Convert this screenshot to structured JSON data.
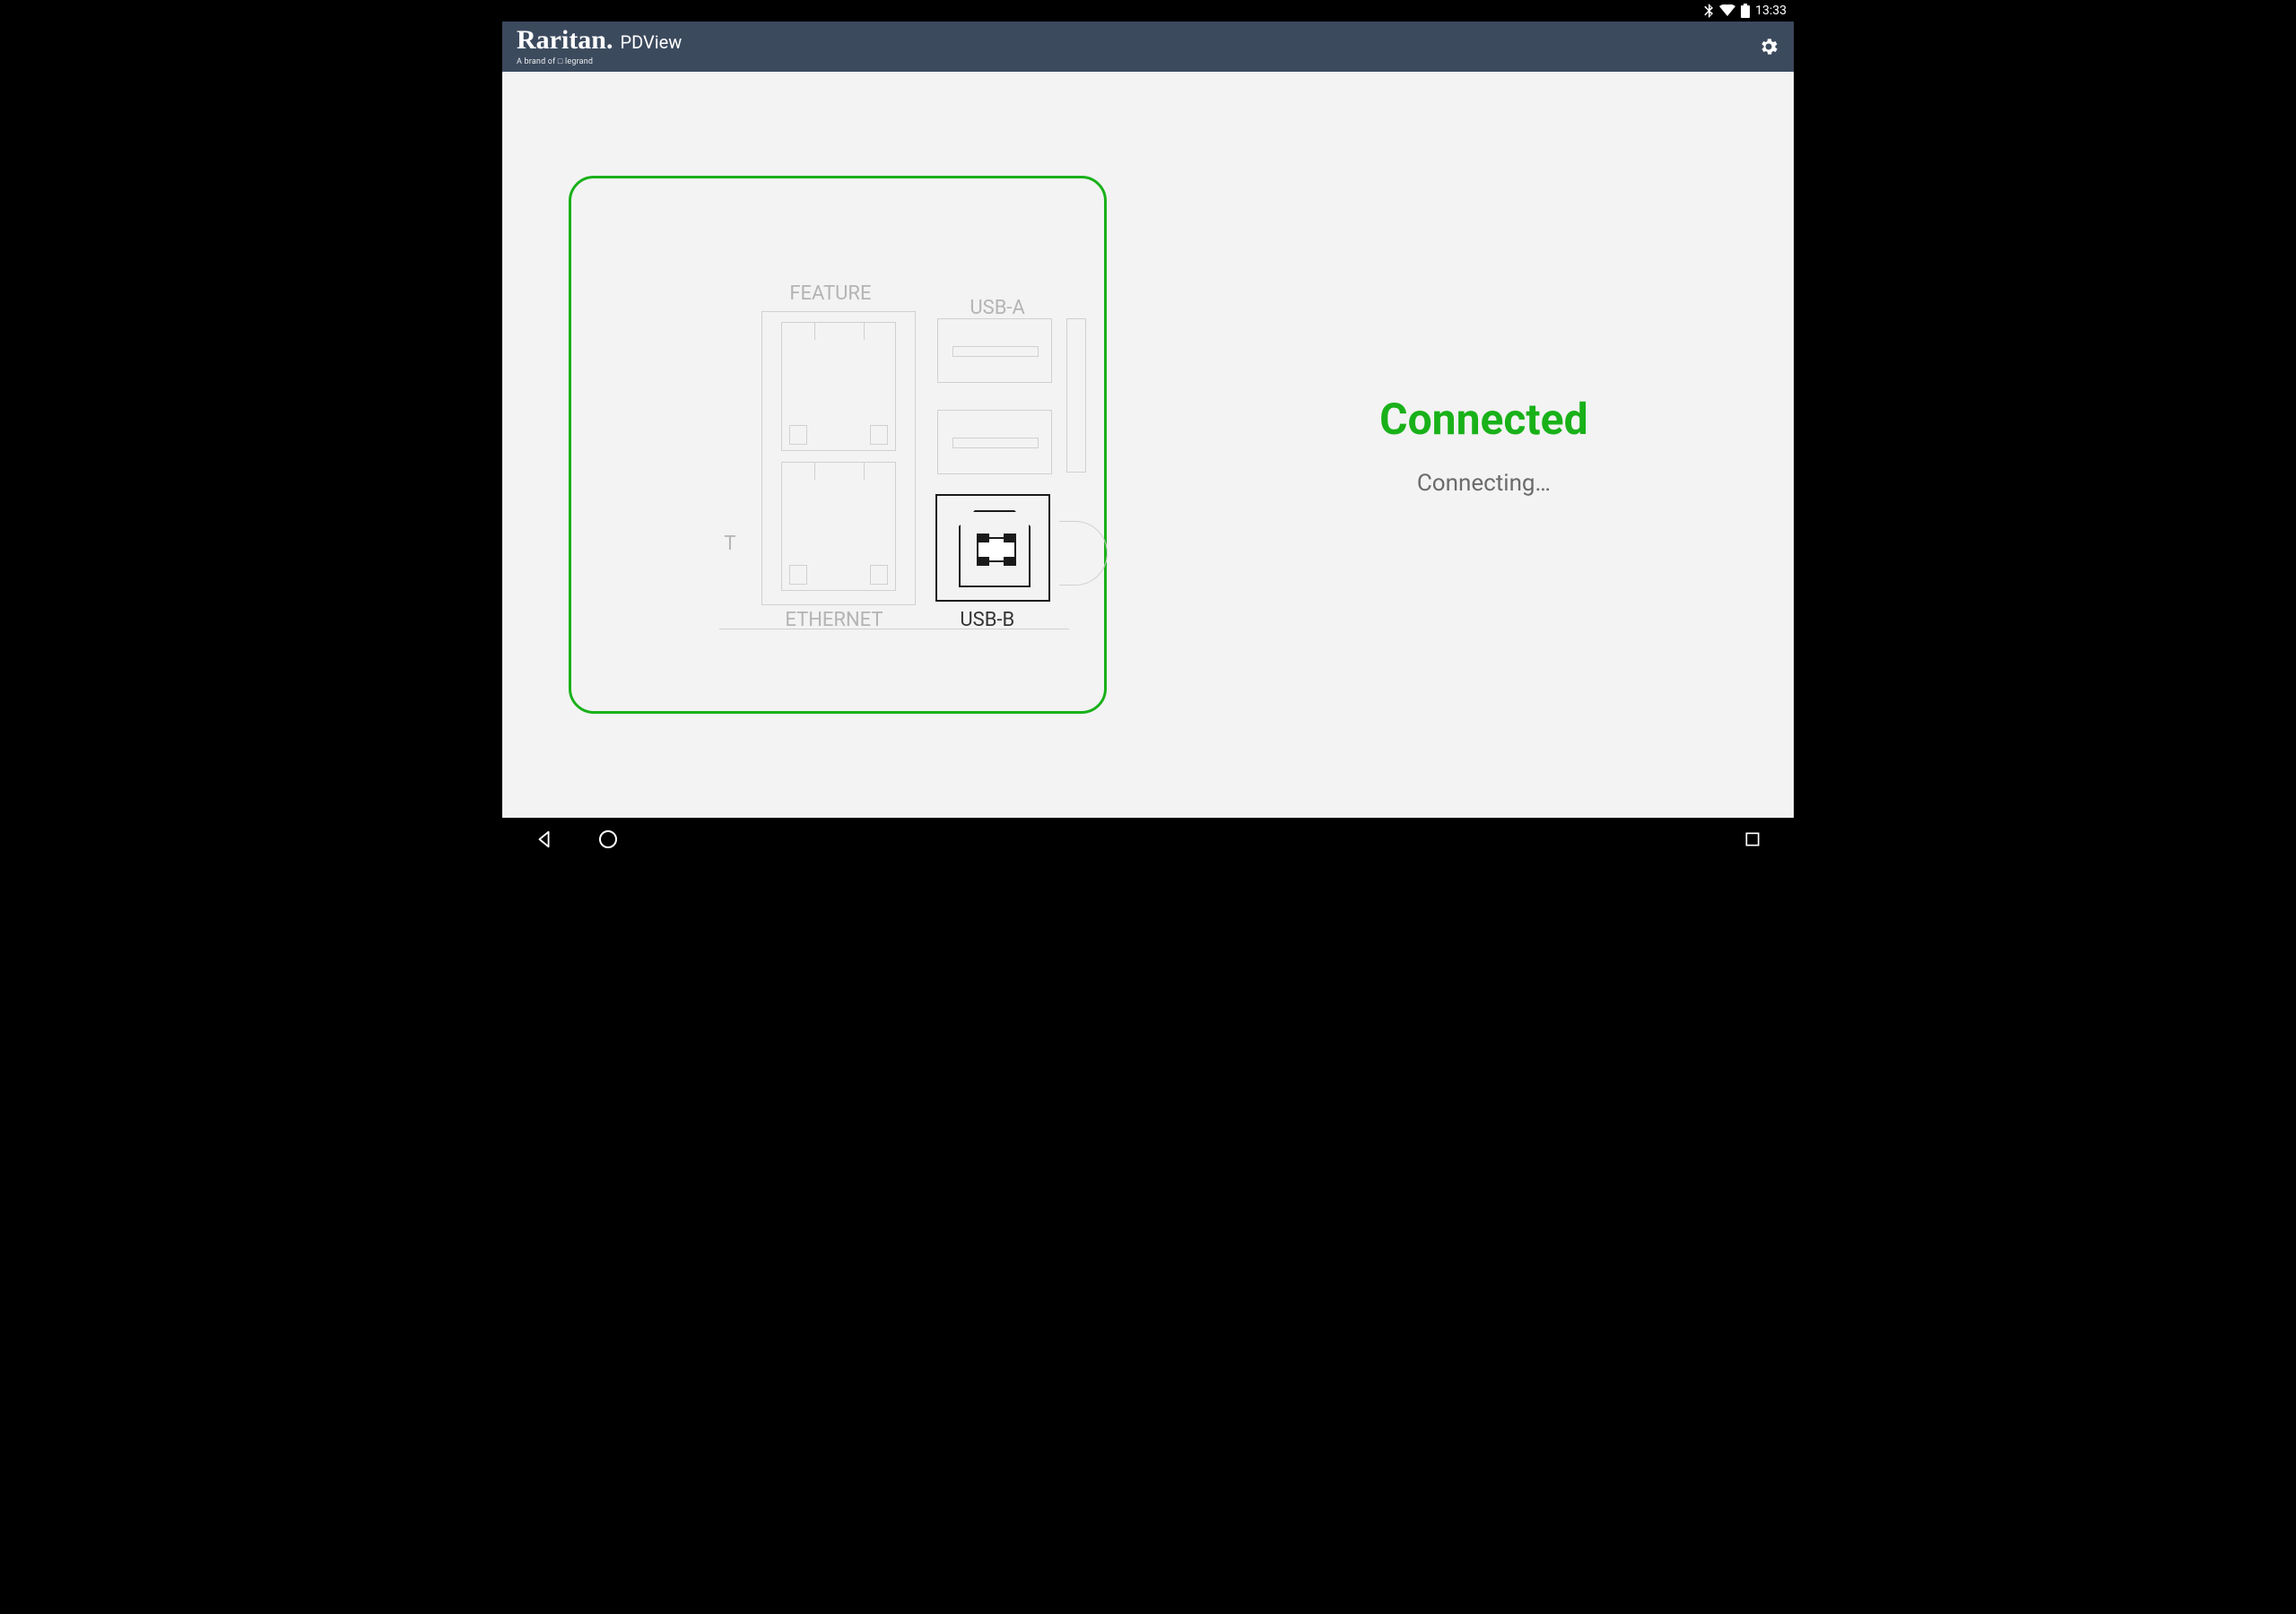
{
  "statusbar": {
    "time": "13:33"
  },
  "appbar": {
    "brand_main": "Raritan.",
    "brand_sub": "A brand of □ legrand",
    "app_title": "PDView"
  },
  "status": {
    "title": "Connected",
    "subtitle": "Connecting…"
  },
  "diagram": {
    "feature_label": "FEATURE",
    "usba_label": "USB-A",
    "ethernet_label": "ETHERNET",
    "usbb_label": "USB-B",
    "t_label": "T"
  },
  "colors": {
    "accent": "#19b119",
    "appbar": "#3c4a5e"
  }
}
